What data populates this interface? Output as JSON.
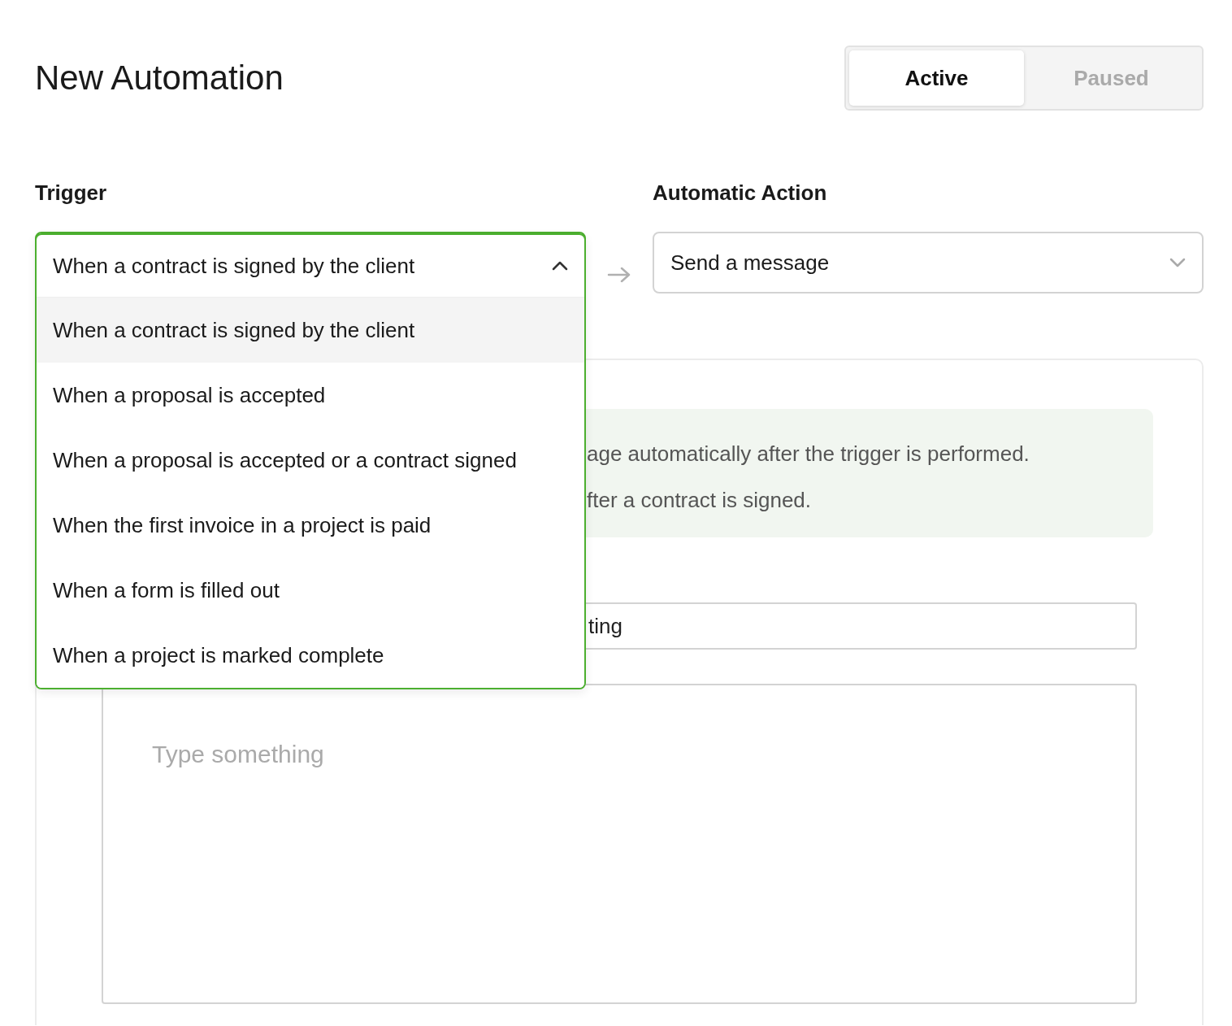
{
  "title": "New Automation",
  "status_toggle": [
    {
      "label": "Active",
      "selected": true
    },
    {
      "label": "Paused",
      "selected": false
    }
  ],
  "trigger": {
    "label": "Trigger",
    "value": "When a contract is signed by the client",
    "expanded": true,
    "options": [
      {
        "label": "When a contract is signed by the client",
        "selected": true
      },
      {
        "label": "When a proposal is accepted",
        "selected": false
      },
      {
        "label": "When a proposal is accepted or a contract signed",
        "selected": false
      },
      {
        "label": "When the first invoice in a project is paid",
        "selected": false
      },
      {
        "label": "When a form is filled out",
        "selected": false
      },
      {
        "label": "When a project is marked complete",
        "selected": false
      }
    ]
  },
  "action": {
    "label": "Automatic Action",
    "value": "Send a message",
    "expanded": false
  },
  "info_lines": [
    "age automatically after the trigger is performed.",
    "fter a contract is signed."
  ],
  "subject_field": {
    "value": "ting"
  },
  "message_field": {
    "placeholder": "Type something"
  }
}
